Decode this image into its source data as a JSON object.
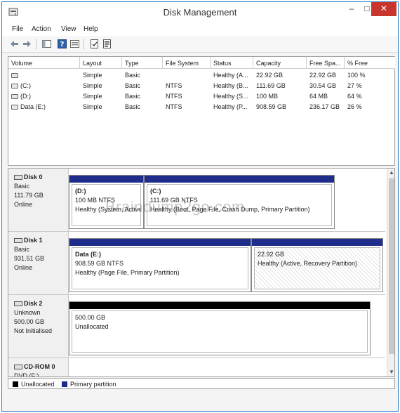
{
  "window": {
    "title": "Disk Management",
    "minimize_glyph": "–",
    "maximize_glyph": "□",
    "close_glyph": "✕"
  },
  "menu": [
    "File",
    "Action",
    "View",
    "Help"
  ],
  "toolbar": {
    "icons": [
      "back-arrow-icon",
      "forward-arrow-icon",
      "console-tree-icon",
      "help-icon",
      "properties-icon",
      "export-list-icon",
      "refresh-icon"
    ]
  },
  "volume_list": {
    "columns": [
      "Volume",
      "Layout",
      "Type",
      "File System",
      "Status",
      "Capacity",
      "Free Spa...",
      "% Free"
    ],
    "rows": [
      [
        "",
        "Simple",
        "Basic",
        "",
        "Healthy (A...",
        "22.92 GB",
        "22.92 GB",
        "100 %"
      ],
      [
        "(C:)",
        "Simple",
        "Basic",
        "NTFS",
        "Healthy (B...",
        "111.69 GB",
        "30.54 GB",
        "27 %"
      ],
      [
        "(D:)",
        "Simple",
        "Basic",
        "NTFS",
        "Healthy (S...",
        "100 MB",
        "64 MB",
        "64 %"
      ],
      [
        "Data (E:)",
        "Simple",
        "Basic",
        "NTFS",
        "Healthy (P...",
        "908.59 GB",
        "236.17 GB",
        "26 %"
      ]
    ]
  },
  "disks": [
    {
      "name": "Disk 0",
      "type": "Basic",
      "size": "111.79 GB",
      "status": "Online",
      "partitions": [
        {
          "name": "(D:)",
          "size": "100 MB NTFS",
          "status": "Healthy (System, Active, Primary Partition)"
        },
        {
          "name": "(C:)",
          "size": "111.69 GB NTFS",
          "status": "Healthy (Boot, Page File, Crash Dump, Primary Partition)"
        }
      ]
    },
    {
      "name": "Disk 1",
      "type": "Basic",
      "size": "931.51 GB",
      "status": "Online",
      "partitions": [
        {
          "name": "Data  (E:)",
          "size": "908.59 GB NTFS",
          "status": "Healthy (Page File, Primary Partition)"
        },
        {
          "name": "",
          "size": "22.92 GB",
          "status": "Healthy (Active, Recovery Partition)"
        }
      ]
    },
    {
      "name": "Disk 2",
      "type": "Unknown",
      "size": "500.00 GB",
      "status": "Not Initialised",
      "partitions": [
        {
          "name": "",
          "size": "500.00 GB",
          "status": "Unallocated"
        }
      ]
    },
    {
      "name": "CD-ROM 0",
      "type": "DVD (F:)",
      "size": "",
      "status": "",
      "partitions": []
    }
  ],
  "legend": [
    {
      "label": "Unallocated",
      "color": "#000000"
    },
    {
      "label": "Primary partition",
      "color": "#1f2d8a"
    }
  ],
  "watermark": "Braindump2go.com",
  "colors": {
    "primary_partition": "#1f2d8a",
    "unallocated": "#000000",
    "close_button": "#c7352c"
  }
}
